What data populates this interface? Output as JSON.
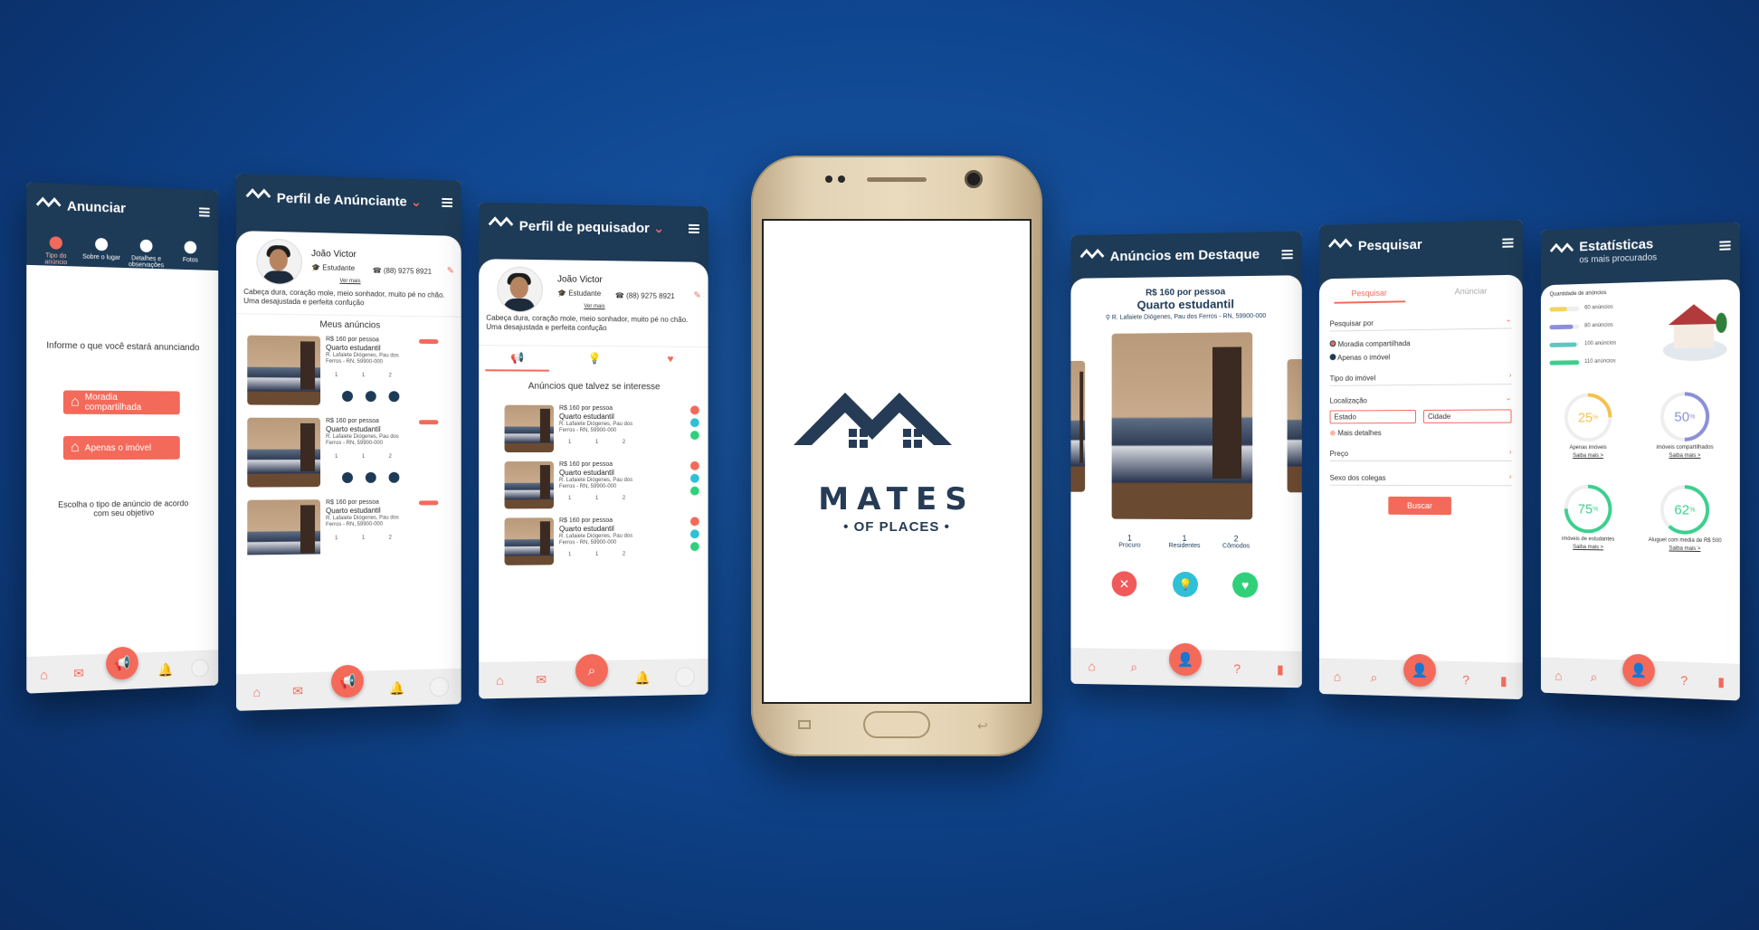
{
  "screens": {
    "anunciar": {
      "title": "Anunciar",
      "steps": [
        "Tipo do anúncio",
        "Sobre o lugar",
        "Detalhes e observações",
        "Fotos"
      ],
      "prompt": "Informe o que você estará anunciando",
      "options": [
        "Moradia compartilhada",
        "Apenas o imóvel"
      ],
      "hint": "Escolha o tipo de anúncio de acordo com seu objetivo"
    },
    "perfil_anunciante": {
      "title": "Perfil de Anúnciante",
      "name": "João Victor",
      "role": "Estudante",
      "phone": "(88) 9275 8921",
      "see_more": "Ver mais",
      "bio": "Cabeça dura, coração mole, meio sonhador, muito pé no chão. Uma desajustada e perfeita confução",
      "section": "Meus anúncios",
      "listings": [
        {
          "price": "R$ 160 por pessoa",
          "type": "Quarto estudantil",
          "address": "R. Lafaiete Diógenes, Pau dos Ferros - RN, 59900-000",
          "n1": "1",
          "n2": "1",
          "n3": "2"
        },
        {
          "price": "R$ 160 por pessoa",
          "type": "Quarto estudantil",
          "address": "R. Lafaiete Diógenes, Pau dos Ferros - RN, 59900-000",
          "n1": "1",
          "n2": "1",
          "n3": "2"
        },
        {
          "price": "R$ 160 por pessoa",
          "type": "Quarto estudantil",
          "address": "R. Lafaiete Diógenes, Pau dos Ferros - RN, 59900-000",
          "n1": "1",
          "n2": "1",
          "n3": "2"
        }
      ]
    },
    "perfil_pesquisador": {
      "title": "Perfil de pequisador",
      "name": "João Victor",
      "role": "Estudante",
      "phone": "(88) 9275 8921",
      "see_more": "Ver mais",
      "bio": "Cabeça dura, coração mole, meio sonhador, muito pé no chão. Uma desajustada e perfeita confução",
      "section": "Anúncios que talvez se interesse",
      "listings": [
        {
          "price": "R$ 160 por pessoa",
          "type": "Quarto estudantil",
          "address": "R. Lafaiete Diógenes, Pau dos Ferros - RN, 59900-000",
          "n1": "1",
          "n2": "1",
          "n3": "2"
        },
        {
          "price": "R$ 160 por pessoa",
          "type": "Quarto estudantil",
          "address": "R. Lafaiete Diógenes, Pau dos Ferros - RN, 59900-000",
          "n1": "1",
          "n2": "1",
          "n3": "2"
        },
        {
          "price": "R$ 160 por pessoa",
          "type": "Quarto estudantil",
          "address": "R. Lafaiete Diógenes, Pau dos Ferros - RN, 59900-000",
          "n1": "1",
          "n2": "1",
          "n3": "2"
        }
      ]
    },
    "destaque": {
      "title": "Anúncios em Destaque",
      "price": "R$ 160 por pessoa",
      "type": "Quarto estudantil",
      "address": "R. Lafaiete Diógenes, Pau dos Ferros - RN, 59900-000",
      "procuro_n": "1",
      "procuro": "Procuro",
      "residentes_n": "1",
      "residentes": "Residentes",
      "comodos_n": "2",
      "comodos": "Cômodos"
    },
    "pesquisar": {
      "title": "Pesquisar",
      "tabs": [
        "Pesquisar",
        "Anúnciar"
      ],
      "search_by": "Pesquisar por",
      "radio": [
        "Moradia compartilhada",
        "Apenas o imóvel"
      ],
      "tipo": "Tipo do imóvel",
      "localizacao": "Localização",
      "estado": "Estado",
      "cidade": "Cidade",
      "mais": "Mais detalhes",
      "preco": "Preço",
      "sexo": "Sexo dos colegas",
      "buscar": "Buscar"
    },
    "estatisticas": {
      "title": "Estatísticas",
      "subtitle": "os mais procurados",
      "qty_label": "Quantidade de anúncios",
      "bars": [
        {
          "label": "60 anúncios",
          "fraction": 0.6,
          "color": "#f4d35e"
        },
        {
          "label": "80 anúncios",
          "fraction": 0.8,
          "color": "#8b8fd6"
        },
        {
          "label": "100 anúncios",
          "fraction": 0.9,
          "color": "#5cc7c0"
        },
        {
          "label": "110 anúncios",
          "fraction": 1.0,
          "color": "#3ccf8e"
        }
      ],
      "stats": [
        {
          "value": "25",
          "label": "Apenas imóveis",
          "link": "Saiba mais",
          "color": "#f2c14e",
          "fraction": 0.25
        },
        {
          "value": "50",
          "label": "imóveis compartilhados",
          "link": "Saiba mais",
          "color": "#8b8fd6",
          "fraction": 0.5
        },
        {
          "value": "75",
          "label": "imóveis de estudantes",
          "link": "Saiba mais",
          "color": "#3ccf8e",
          "fraction": 0.75
        },
        {
          "value": "62",
          "label": "Aluguel com media de R$ 500",
          "link": "Saiba mais",
          "color": "#3ccf8e",
          "fraction": 0.62
        }
      ],
      "percent": "%"
    }
  },
  "brand": {
    "name": "MATES",
    "tagline": "OF PLACES",
    "dark": "#263b55",
    "coral": "#f36a5a"
  }
}
